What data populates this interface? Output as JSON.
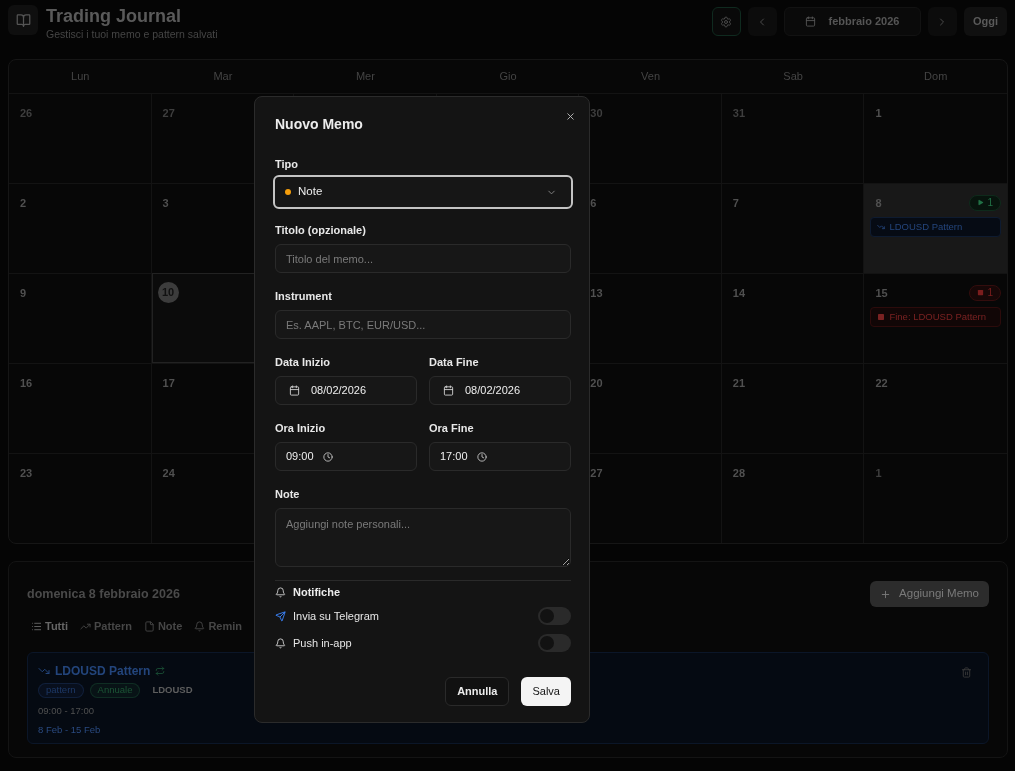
{
  "header": {
    "title": "Trading Journal",
    "subtitle": "Gestisci i tuoi memo e pattern salvati",
    "month_label": "febbraio 2026",
    "today_button": "Oggi"
  },
  "calendar": {
    "weekdays": [
      "Lun",
      "Mar",
      "Mer",
      "Gio",
      "Ven",
      "Sab",
      "Dom"
    ],
    "weeks": [
      [
        {
          "kind": "day",
          "day": "26",
          "outside": true,
          "selected": false,
          "today": false
        },
        {
          "kind": "day",
          "day": "27",
          "outside": true,
          "selected": false,
          "today": false
        },
        {
          "kind": "blank"
        },
        {
          "kind": "blank"
        },
        {
          "kind": "day",
          "day": "30",
          "outside": true,
          "selected": false,
          "today": false
        },
        {
          "kind": "day",
          "day": "31",
          "outside": true,
          "selected": false,
          "today": false
        },
        {
          "kind": "day",
          "day": "1",
          "outside": false,
          "selected": false,
          "today": false
        }
      ],
      [
        {
          "kind": "day",
          "day": "2",
          "outside": false,
          "selected": false,
          "today": false
        },
        {
          "kind": "day",
          "day": "3",
          "outside": false,
          "selected": false,
          "today": false
        },
        {
          "kind": "blank"
        },
        {
          "kind": "blank"
        },
        {
          "kind": "day",
          "day": "6",
          "outside": false,
          "selected": false,
          "today": false
        },
        {
          "kind": "day",
          "day": "7",
          "outside": false,
          "selected": false,
          "today": false
        },
        {
          "kind": "day",
          "day": "8",
          "outside": false,
          "selected": true,
          "today": false,
          "badge": {
            "kind": "start",
            "count": "1"
          },
          "events": [
            {
              "kind": "pattern",
              "label": "LDOUSD Pattern"
            }
          ]
        }
      ],
      [
        {
          "kind": "day",
          "day": "9",
          "outside": false,
          "selected": false,
          "today": false
        },
        {
          "kind": "day",
          "day": "10",
          "outside": false,
          "selected": false,
          "today": true
        },
        {
          "kind": "blank"
        },
        {
          "kind": "blank"
        },
        {
          "kind": "day",
          "day": "13",
          "outside": false,
          "selected": false,
          "today": false
        },
        {
          "kind": "day",
          "day": "14",
          "outside": false,
          "selected": false,
          "today": false
        },
        {
          "kind": "day",
          "day": "15",
          "outside": false,
          "selected": false,
          "today": false,
          "badge": {
            "kind": "end",
            "count": "1"
          },
          "events": [
            {
              "kind": "end",
              "label": "Fine: LDOUSD Pattern"
            }
          ]
        }
      ],
      [
        {
          "kind": "day",
          "day": "16",
          "outside": false,
          "selected": false,
          "today": false
        },
        {
          "kind": "day",
          "day": "17",
          "outside": false,
          "selected": false,
          "today": false
        },
        {
          "kind": "blank"
        },
        {
          "kind": "blank"
        },
        {
          "kind": "day",
          "day": "20",
          "outside": false,
          "selected": false,
          "today": false
        },
        {
          "kind": "day",
          "day": "21",
          "outside": false,
          "selected": false,
          "today": false
        },
        {
          "kind": "day",
          "day": "22",
          "outside": false,
          "selected": false,
          "today": false
        }
      ],
      [
        {
          "kind": "day",
          "day": "23",
          "outside": false,
          "selected": false,
          "today": false
        },
        {
          "kind": "day",
          "day": "24",
          "outside": false,
          "selected": false,
          "today": false
        },
        {
          "kind": "blank"
        },
        {
          "kind": "blank"
        },
        {
          "kind": "day",
          "day": "27",
          "outside": false,
          "selected": false,
          "today": false
        },
        {
          "kind": "day",
          "day": "28",
          "outside": false,
          "selected": false,
          "today": false
        },
        {
          "kind": "day",
          "day": "1",
          "outside": true,
          "selected": false,
          "today": false
        }
      ]
    ]
  },
  "day_panel": {
    "heading": "domenica 8 febbraio 2026",
    "add_button": "Aggiungi Memo",
    "filters": [
      {
        "kind": "all",
        "label": "Tutti",
        "selected": true
      },
      {
        "kind": "pattern",
        "label": "Pattern",
        "selected": false
      },
      {
        "kind": "note",
        "label": "Note",
        "selected": false
      },
      {
        "kind": "reminder",
        "label": "Remin",
        "selected": false
      }
    ],
    "memos": [
      {
        "kind": "pattern",
        "title": "LDOUSD Pattern",
        "recurring": true,
        "tags": [
          {
            "label": "pattern",
            "color": "#1d3866"
          },
          {
            "label": "Annuale",
            "color": "#1c5536"
          }
        ],
        "instrument": "LDOUSD",
        "time": "09:00 - 17:00",
        "date_range": "8 Feb - 15 Feb"
      }
    ]
  },
  "modal": {
    "title": "Nuovo Memo",
    "type_field": {
      "label": "Tipo",
      "value": "Note",
      "focused": true
    },
    "title_field": {
      "label": "Titolo (opzionale)",
      "placeholder": "Titolo del memo..."
    },
    "instrument_field": {
      "label": "Instrument",
      "placeholder": "Es. AAPL, BTC, EUR/USD..."
    },
    "date_fields": [
      {
        "label": "Data Inizio",
        "value": "08/02/2026"
      },
      {
        "label": "Data Fine",
        "value": "08/02/2026"
      }
    ],
    "time_fields": [
      {
        "label": "Ora Inizio",
        "value": "09:00"
      },
      {
        "label": "Ora Fine",
        "value": "17:00"
      }
    ],
    "notes_field": {
      "label": "Note",
      "placeholder": "Aggiungi note personali..."
    },
    "notifications": {
      "heading": "Notifiche",
      "options": [
        {
          "kind": "telegram",
          "label": "Invia su Telegram",
          "on": false
        },
        {
          "kind": "push",
          "label": "Push in-app",
          "on": false
        }
      ]
    },
    "cancel_button": "Annulla",
    "save_button": "Salva"
  }
}
